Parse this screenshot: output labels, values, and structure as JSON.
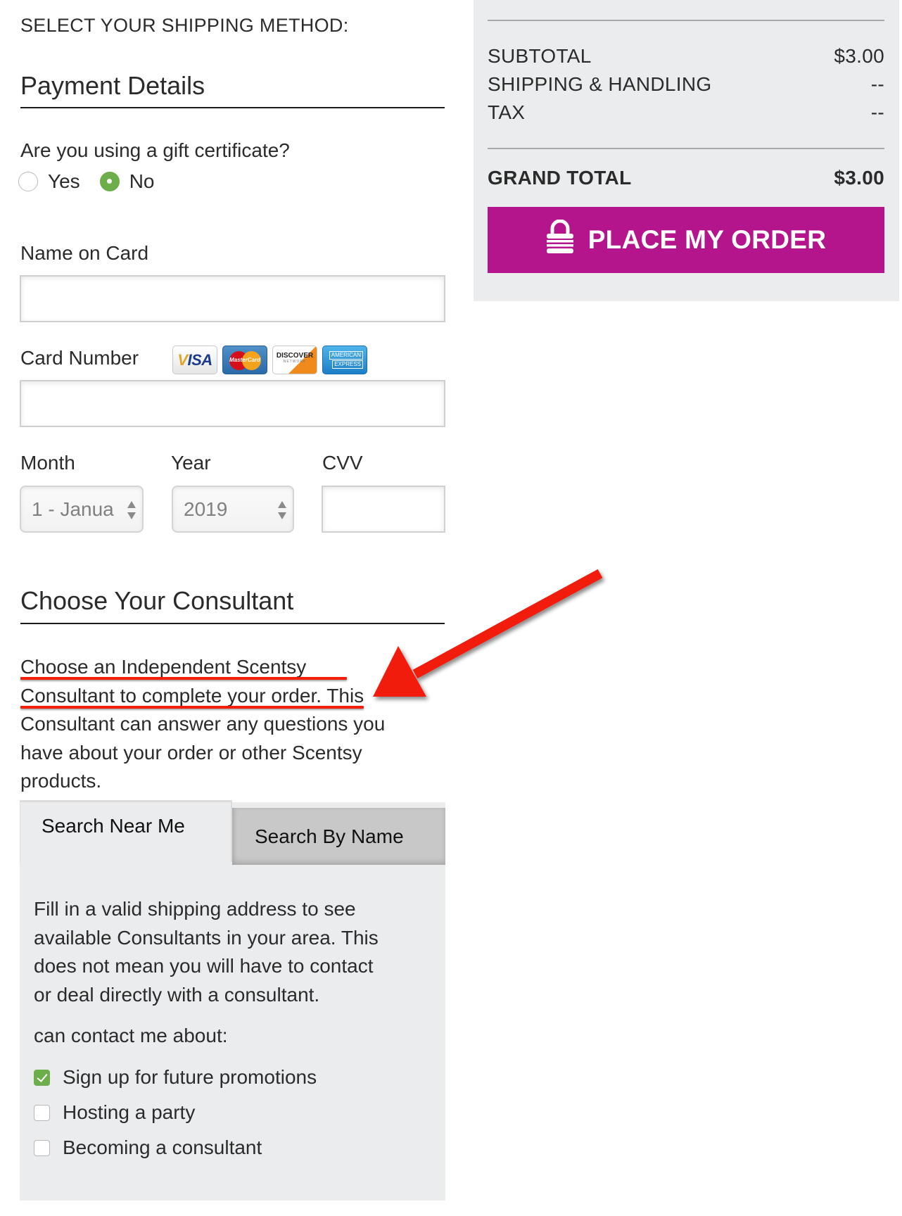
{
  "shipping": {
    "title": "SELECT YOUR SHIPPING METHOD:"
  },
  "payment": {
    "heading": "Payment Details",
    "gift_question": "Are you using a gift certificate?",
    "gift_options": [
      {
        "label": "Yes",
        "selected": false
      },
      {
        "label": "No",
        "selected": true
      }
    ],
    "name_label": "Name on Card",
    "name_value": "",
    "card_number_label": "Card Number",
    "card_number_value": "",
    "card_brands": [
      {
        "name": "visa-icon",
        "label": "VISA"
      },
      {
        "name": "mastercard-icon",
        "label": "MasterCard"
      },
      {
        "name": "discover-icon",
        "label": "DISCOVER",
        "sublabel": "NETWORK"
      },
      {
        "name": "amex-icon",
        "label": "AMERICAN",
        "sublabel": "EXPRESS"
      }
    ],
    "month_label": "Month",
    "month_value": "1 - Janua",
    "year_label": "Year",
    "year_value": "2019",
    "cvv_label": "CVV",
    "cvv_value": ""
  },
  "consultant": {
    "heading": "Choose Your Consultant",
    "paragraph_lines": [
      "Choose an Independent Scentsy",
      "Consultant to complete your order. This",
      "Consultant can answer any questions you",
      "have about your order or other Scentsy",
      "products."
    ],
    "tabs": [
      {
        "label": "Search Near Me",
        "active": true
      },
      {
        "label": "Search By Name",
        "active": false
      }
    ],
    "tab_body_lines": [
      "Fill in a valid shipping address to see",
      "available Consultants in your area. This",
      "does not mean you will have to contact",
      "or deal directly with a consultant."
    ],
    "contact_label": "can contact me about:",
    "contact_options": [
      {
        "label": "Sign up for future promotions",
        "checked": true
      },
      {
        "label": "Hosting a party",
        "checked": false
      },
      {
        "label": "Becoming a consultant",
        "checked": false
      }
    ]
  },
  "summary": {
    "rows": [
      {
        "label": "SUBTOTAL",
        "value": "$3.00"
      },
      {
        "label": "SHIPPING & HANDLING",
        "value": "--"
      },
      {
        "label": "TAX",
        "value": "--"
      }
    ],
    "grand_total_label": "GRAND TOTAL",
    "grand_total_value": "$3.00",
    "place_order_label": "PLACE MY ORDER"
  },
  "colors": {
    "accent_button": "#b5158c",
    "check_green": "#6cae4a",
    "annotation_red": "#f21d0c",
    "panel_bg": "#ebecee"
  }
}
